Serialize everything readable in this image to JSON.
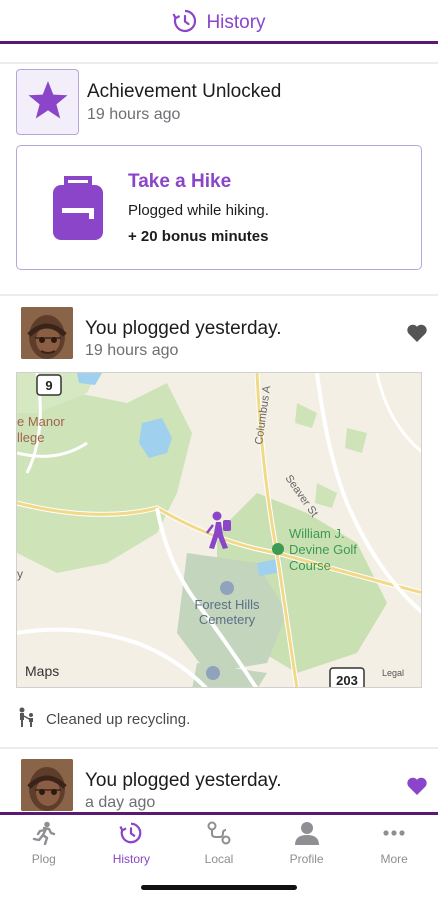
{
  "header": {
    "title": "History",
    "icon": "history-icon",
    "accent": "#8a45c9",
    "rule_color": "#5a1a72"
  },
  "achievement": {
    "title": "Achievement Unlocked",
    "time": "19 hours ago",
    "icon": "star-icon",
    "card": {
      "title": "Take a Hike",
      "description": "Plogged while hiking.",
      "bonus": "+ 20 bonus minutes",
      "icon": "backpack-icon"
    }
  },
  "posts": [
    {
      "title": "You plogged yesterday.",
      "time": "19 hours ago",
      "liked": false,
      "map": {
        "labels": {
          "route_9": "9",
          "route_203": "203",
          "manor": "e Manor",
          "college": "llege",
          "columbus": "Columbus A",
          "seaver": "Seaver St",
          "golf_line1": "William J.",
          "golf_line2": "Devine Golf",
          "golf_line3": "Course",
          "cemetery_line1": "Forest Hills",
          "cemetery_line2": "Cemetery",
          "left_edge": "y",
          "maps_brand": "Maps",
          "legal": "Legal"
        }
      },
      "activity": "Cleaned up recycling."
    },
    {
      "title": "You plogged yesterday.",
      "time": "a day ago",
      "liked": true
    }
  ],
  "tabs": [
    {
      "label": "Plog",
      "icon": "runner-icon",
      "active": false
    },
    {
      "label": "History",
      "icon": "history-icon",
      "active": true
    },
    {
      "label": "Local",
      "icon": "route-icon",
      "active": false
    },
    {
      "label": "Profile",
      "icon": "person-icon",
      "active": false
    },
    {
      "label": "More",
      "icon": "ellipsis-icon",
      "active": false
    }
  ]
}
